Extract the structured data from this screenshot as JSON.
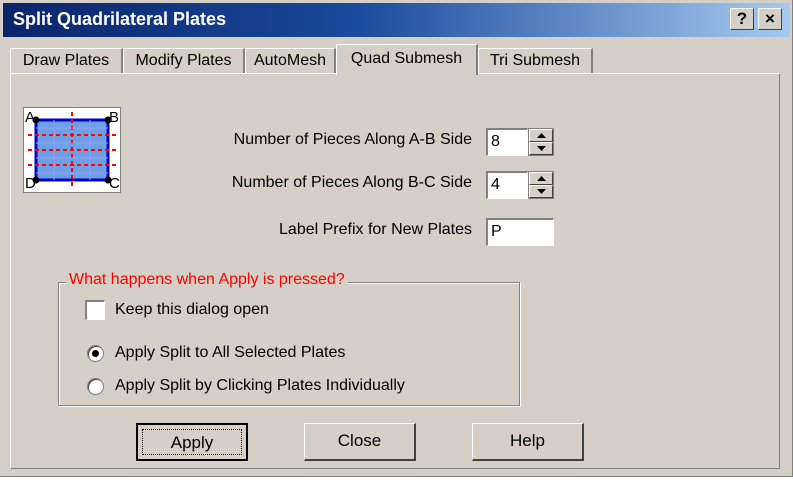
{
  "window": {
    "title": "Split Quadrilateral Plates",
    "help_button": "?",
    "close_button": "×"
  },
  "tabs": [
    {
      "label": "Draw Plates"
    },
    {
      "label": "Modify Plates"
    },
    {
      "label": "AutoMesh"
    },
    {
      "label": "Quad Submesh",
      "active": true
    },
    {
      "label": "Tri Submesh"
    }
  ],
  "preview": {
    "corner_a": "A",
    "corner_b": "B",
    "corner_c": "C",
    "corner_d": "D"
  },
  "fields": {
    "pieces_ab": {
      "label": "Number of Pieces Along A-B Side",
      "value": "8"
    },
    "pieces_bc": {
      "label": "Number of Pieces Along B-C Side",
      "value": "4"
    },
    "label_prefix": {
      "label": "Label Prefix for New Plates",
      "value": "P"
    }
  },
  "apply_group": {
    "legend": "What happens when Apply is pressed?",
    "keep_open": {
      "label": "Keep this dialog open",
      "checked": false
    },
    "options": [
      {
        "label": "Apply Split to All Selected Plates",
        "selected": true
      },
      {
        "label": "Apply Split by Clicking Plates Individually",
        "selected": false
      }
    ]
  },
  "buttons": {
    "apply": "Apply",
    "close": "Close",
    "help": "Help"
  },
  "colors": {
    "title_gradient_start": "#0a246a",
    "title_gradient_end": "#a6caf0",
    "dialog_bg": "#d4d0c8",
    "legend_text": "#ff0000",
    "preview_fill": "#6ea0e6",
    "preview_edge": "#0000cc",
    "preview_split_lines": "#ff0000"
  }
}
